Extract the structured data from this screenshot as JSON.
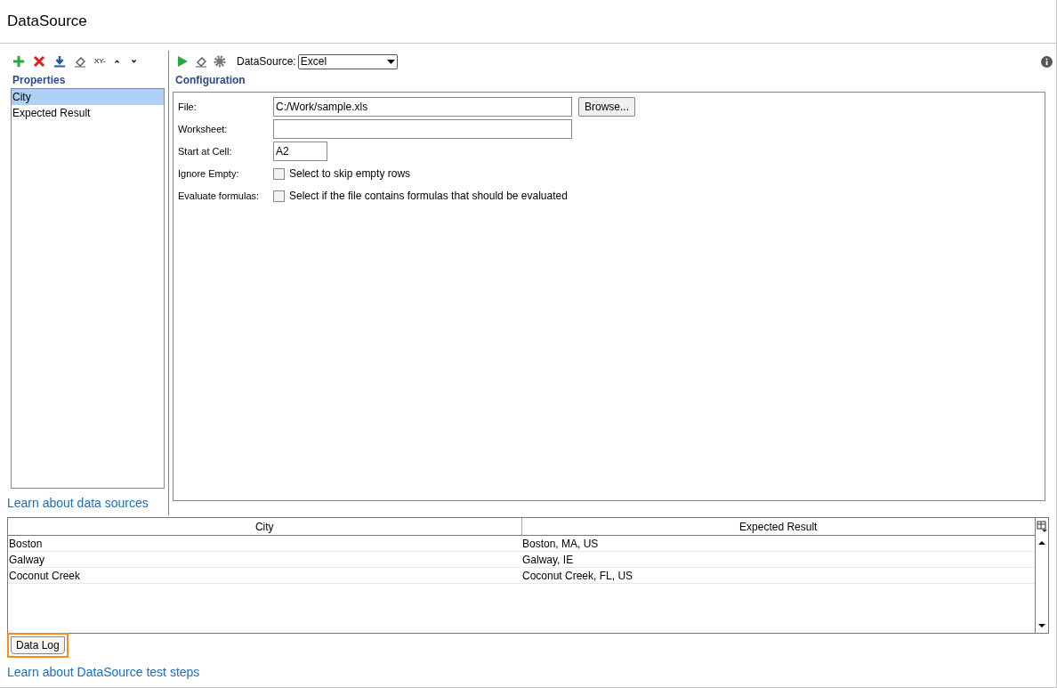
{
  "title": "DataSource",
  "properties": {
    "heading": "Properties",
    "items": [
      {
        "label": "City",
        "selected": true
      },
      {
        "label": "Expected Result",
        "selected": false
      }
    ],
    "link": "Learn about data sources"
  },
  "config": {
    "datasource_label": "DataSource:",
    "datasource_value": "Excel",
    "heading": "Configuration",
    "fields": [
      {
        "kind": "text",
        "label": "File:",
        "value": "C:/Work/sample.xls",
        "button": "Browse..."
      },
      {
        "kind": "text",
        "label": "Worksheet:"
      },
      {
        "kind": "short",
        "label": "Start at Cell:",
        "value": "A2"
      },
      {
        "kind": "check",
        "label": "Ignore Empty:",
        "text": "Select to skip empty rows",
        "checked": false
      },
      {
        "kind": "check",
        "label": "Evaluate formulas:",
        "text": "Select if the file contains formulas that should be evaluated",
        "checked": false
      }
    ]
  },
  "table": {
    "columns": [
      "City",
      "Expected Result"
    ],
    "rows": [
      [
        "Boston",
        "Boston, MA, US"
      ],
      [
        "Galway",
        "Galway, IE"
      ],
      [
        "Coconut Creek",
        "Coconut Creek, FL, US"
      ]
    ]
  },
  "data_log_tab": "Data Log",
  "footer_link": "Learn about DataSource test steps",
  "properties_toolbar_text": "XY-"
}
